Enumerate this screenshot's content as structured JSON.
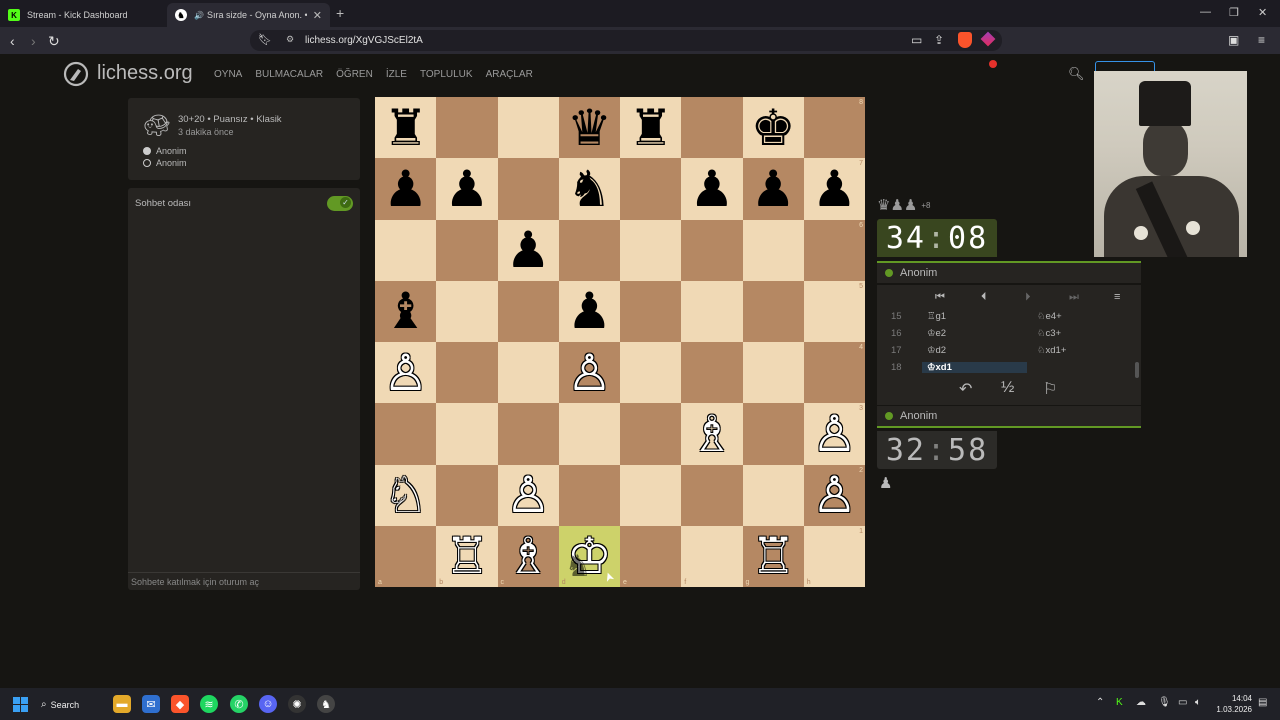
{
  "browser": {
    "tabs": [
      {
        "title": "Stream - Kick Dashboard",
        "favicon": "K"
      },
      {
        "title": "Sıra sizde - Oyna Anon. • lich",
        "favicon": "♞"
      }
    ],
    "url": "lichess.org/XgVGJScEl2tA"
  },
  "lichess": {
    "brand": "lichess.org",
    "nav": [
      "OYNA",
      "BULMACALAR",
      "ÖĞREN",
      "İZLE",
      "TOPLULUK",
      "ARAÇLAR"
    ]
  },
  "game_info": {
    "setup": "30+20 • Puansız • Klasik",
    "time_ago": "3 dakika önce",
    "white_player": "Anonim",
    "black_player": "Anonim"
  },
  "chat": {
    "title": "Sohbet odası",
    "placeholder": "Sohbete katılmak için oturum aç"
  },
  "board": {
    "orientation": "white",
    "last_move_square": "d1",
    "ranks": [
      [
        "♜",
        "",
        "",
        "♛",
        "♜",
        "",
        "♚",
        ""
      ],
      [
        "♟",
        "♟",
        "",
        "♞",
        "",
        "♟",
        "♟",
        "♟"
      ],
      [
        "",
        "",
        "♟",
        "",
        "",
        "",
        "",
        ""
      ],
      [
        "♝",
        "",
        "",
        "♟",
        "",
        "",
        "",
        ""
      ],
      [
        "♙",
        "",
        "",
        "♙",
        "",
        "",
        "",
        ""
      ],
      [
        "",
        "",
        "",
        "",
        "",
        "♗",
        "",
        "♙"
      ],
      [
        "♘",
        "",
        "♙",
        "",
        "",
        "",
        "",
        "♙"
      ],
      [
        "",
        "♖",
        "♗",
        "♔",
        "",
        "",
        "♖",
        ""
      ]
    ],
    "colors": [
      [
        "b",
        "",
        "",
        "b",
        "b",
        "",
        "b",
        ""
      ],
      [
        "b",
        "b",
        "",
        "b",
        "",
        "b",
        "b",
        "b"
      ],
      [
        "",
        "",
        "b",
        "",
        "",
        "",
        "",
        ""
      ],
      [
        "b",
        "",
        "",
        "b",
        "",
        "",
        "",
        ""
      ],
      [
        "w",
        "",
        "",
        "w",
        "",
        "",
        "",
        ""
      ],
      [
        "",
        "",
        "",
        "",
        "",
        "w",
        "",
        "w"
      ],
      [
        "w",
        "",
        "w",
        "",
        "",
        "",
        "",
        "w"
      ],
      [
        "",
        "w",
        "w",
        "w",
        "",
        "",
        "w",
        ""
      ]
    ],
    "rank_labels": [
      "8",
      "7",
      "6",
      "5",
      "4",
      "3",
      "2",
      "1"
    ],
    "file_labels": [
      "a",
      "b",
      "c",
      "d",
      "e",
      "f",
      "g",
      "h"
    ]
  },
  "right_panel": {
    "captured": "♛♟♟",
    "advantage": "+8",
    "top_clock": {
      "min": "34",
      "sec": "08"
    },
    "top_player": "Anonim",
    "bottom_player": "Anonim",
    "bottom_clock": {
      "min": "32",
      "sec": "58"
    },
    "moves": [
      {
        "n": "15",
        "w": "♖g1",
        "b": "♘e4+"
      },
      {
        "n": "16",
        "w": "♔e2",
        "b": "♘c3+"
      },
      {
        "n": "17",
        "w": "♔d2",
        "b": "♘xd1+"
      },
      {
        "n": "18",
        "w": "♔xd1",
        "b": ""
      }
    ],
    "draw_label": "½"
  },
  "taskbar": {
    "search_label": "Search",
    "time": "14:04",
    "date": "1.03.2026"
  }
}
